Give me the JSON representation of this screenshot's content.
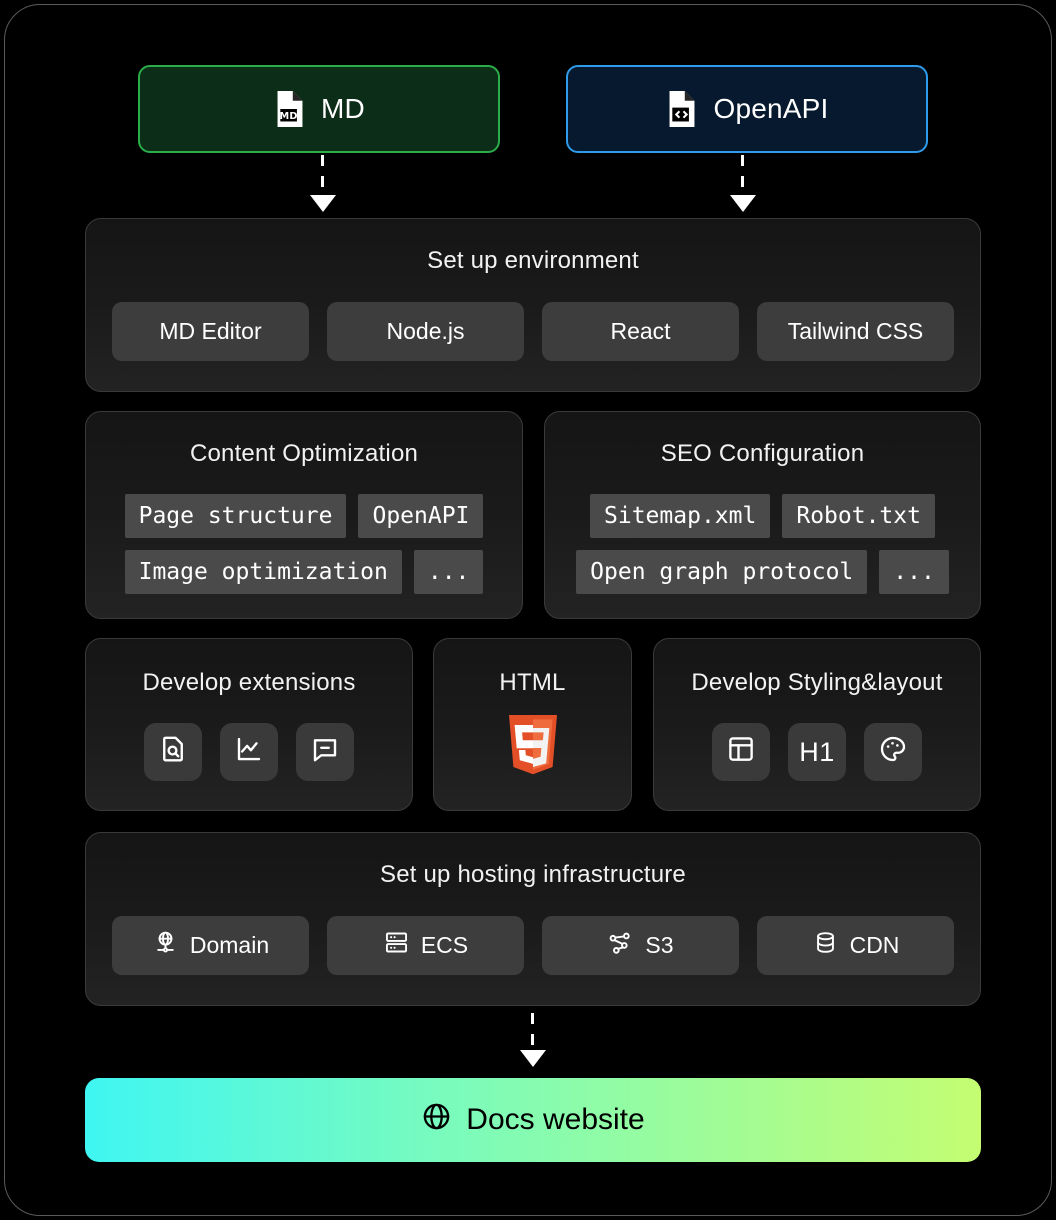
{
  "sources": [
    {
      "label": "MD",
      "icon": "md-file-icon",
      "border": "#2bad4a",
      "fill": "#0c2d17"
    },
    {
      "label": "OpenAPI",
      "icon": "code-file-icon",
      "border": "#2f9bea",
      "fill": "#07192f"
    }
  ],
  "environment": {
    "title": "Set up environment",
    "items": [
      "MD Editor",
      "Node.js",
      "React",
      "Tailwind CSS"
    ]
  },
  "content_optimization": {
    "title": "Content Optimization",
    "items": [
      "Page structure",
      "OpenAPI",
      "Image optimization",
      "..."
    ]
  },
  "seo_configuration": {
    "title": "SEO Configuration",
    "items": [
      "Sitemap.xml",
      "Robot.txt",
      "Open graph protocol",
      "..."
    ]
  },
  "develop_extensions": {
    "title": "Develop extensions",
    "icons": [
      "document-search-icon",
      "line-chart-icon",
      "comment-icon"
    ]
  },
  "html_block": {
    "title": "HTML",
    "icon": "html5-logo",
    "logo_color": "#e34f26"
  },
  "develop_styling": {
    "title": "Develop Styling&layout",
    "icons": [
      "layout-grid-icon",
      "heading-h1-icon",
      "color-palette-icon"
    ],
    "h1_label": "H1"
  },
  "hosting": {
    "title": "Set up hosting infrastructure",
    "items": [
      {
        "label": "Domain",
        "icon": "globe-stand-icon"
      },
      {
        "label": "ECS",
        "icon": "server-rack-icon"
      },
      {
        "label": "S3",
        "icon": "node-graph-icon"
      },
      {
        "label": "CDN",
        "icon": "database-icon"
      }
    ]
  },
  "result": {
    "label": "Docs website",
    "icon": "globe-icon",
    "gradient_start": "#3ff6f2",
    "gradient_end": "#c4fd72"
  }
}
